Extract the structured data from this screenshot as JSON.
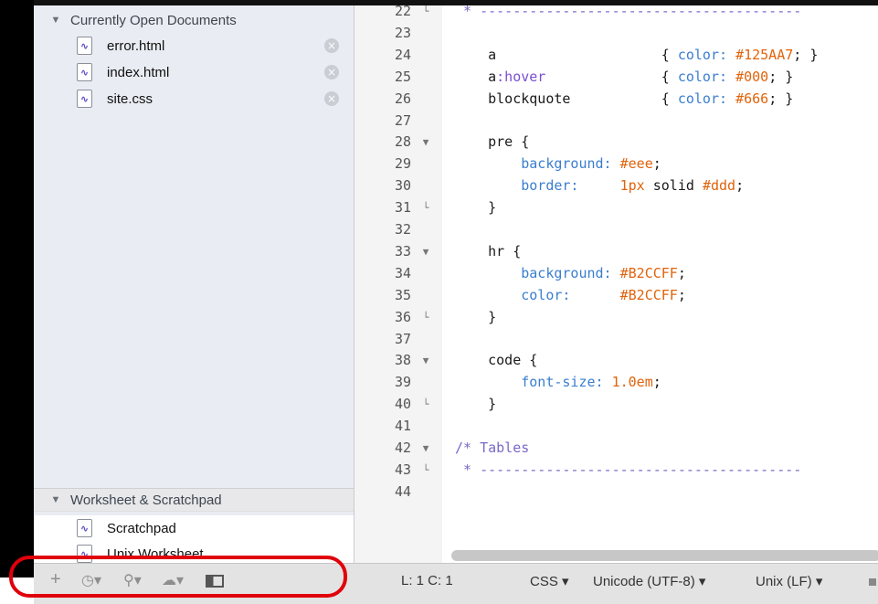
{
  "sidebar": {
    "open_documents_header": "Currently Open Documents",
    "open_documents": [
      {
        "name": "error.html",
        "icon": "document-icon"
      },
      {
        "name": "index.html",
        "icon": "document-icon"
      },
      {
        "name": "site.css",
        "icon": "document-icon"
      }
    ],
    "worksheet_header": "Worksheet & Scratchpad",
    "worksheet_items": [
      {
        "name": "Scratchpad",
        "icon": "document-icon"
      },
      {
        "name": "Unix Worksheet",
        "icon": "document-icon"
      }
    ]
  },
  "editor": {
    "language_colors": {
      "comment": "#7a68c7",
      "number": "#e1630b",
      "property": "#3a7ed0"
    },
    "lines": [
      {
        "n": "22",
        "fold": "end",
        "code": " * ---------------------------------------"
      },
      {
        "n": "23",
        "fold": "",
        "code": ""
      },
      {
        "n": "24",
        "fold": "",
        "code": "    a                    { color: #125AA7; }"
      },
      {
        "n": "25",
        "fold": "",
        "code": "    a:hover              { color: #000; }"
      },
      {
        "n": "26",
        "fold": "",
        "code": "    blockquote           { color: #666; }"
      },
      {
        "n": "27",
        "fold": "",
        "code": ""
      },
      {
        "n": "28",
        "fold": "start",
        "code": "    pre {"
      },
      {
        "n": "29",
        "fold": "",
        "code": "        background: #eee;"
      },
      {
        "n": "30",
        "fold": "",
        "code": "        border:     1px solid #ddd;"
      },
      {
        "n": "31",
        "fold": "end",
        "code": "    }"
      },
      {
        "n": "32",
        "fold": "",
        "code": ""
      },
      {
        "n": "33",
        "fold": "start",
        "code": "    hr {"
      },
      {
        "n": "34",
        "fold": "",
        "code": "        background: #B2CCFF;"
      },
      {
        "n": "35",
        "fold": "",
        "code": "        color:      #B2CCFF;"
      },
      {
        "n": "36",
        "fold": "end",
        "code": "    }"
      },
      {
        "n": "37",
        "fold": "",
        "code": ""
      },
      {
        "n": "38",
        "fold": "start",
        "code": "    code {"
      },
      {
        "n": "39",
        "fold": "",
        "code": "        font-size: 1.0em;"
      },
      {
        "n": "40",
        "fold": "end",
        "code": "    }"
      },
      {
        "n": "41",
        "fold": "",
        "code": ""
      },
      {
        "n": "42",
        "fold": "start",
        "code": "/* Tables"
      },
      {
        "n": "43",
        "fold": "end",
        "code": " * ---------------------------------------"
      },
      {
        "n": "44",
        "fold": "",
        "code": ""
      }
    ]
  },
  "statusbar": {
    "add_icon": "plus-icon",
    "history_icon": "clock-icon",
    "search_icon": "magnifier-icon",
    "cloud_icon": "cloud-icon",
    "panel_icon": "sidebar-toggle-icon",
    "position": "L: 1 C: 1",
    "language": "CSS",
    "encoding": "Unicode (UTF-8)",
    "line_endings": "Unix (LF)"
  },
  "annotation": {
    "color": "#e0000b"
  }
}
